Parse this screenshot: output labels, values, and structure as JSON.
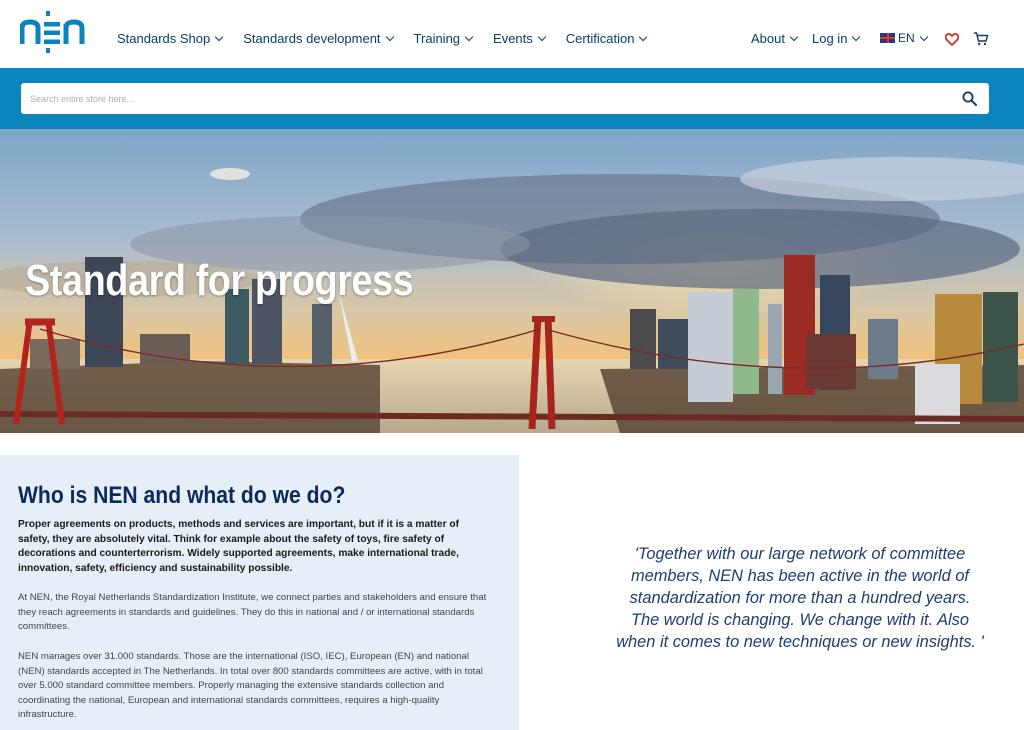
{
  "brand": {
    "logo_text": "nen"
  },
  "nav": {
    "items": [
      {
        "label": "Standards Shop"
      },
      {
        "label": "Standards development"
      },
      {
        "label": "Training"
      },
      {
        "label": "Events"
      },
      {
        "label": "Certification"
      }
    ],
    "about": "About",
    "login": "Log in",
    "language": "EN"
  },
  "search": {
    "placeholder": "Search entire store here..."
  },
  "hero": {
    "title": "Standard for progress"
  },
  "info": {
    "title": "Who is NEN and what do we do?",
    "lead": "Proper agreements on products, methods and services are important, but if it is a matter of safety, they are absolutely vital. Think for example about the safety of toys, fire safety of decorations and counterterrorism. Widely supported agreements, make international trade, innovation, safety, efficiency and sustainability possible.",
    "p1": "At NEN, the Royal Netherlands Standardization Institute, we connect parties and stakeholders and ensure that they reach agreements in standards and guidelines. They do this in national and / or international standards committees.",
    "p2": "NEN manages over 31.000 standards. Those are the international (ISO, IEC), European (EN) and national (NEN) standards accepted in The Netherlands. In total over 800 standards committees are active, with in total over 5.000 standard committee members. Properly managing the extensive standards collection and coordinating the national, European and international standards committees, requires a high-quality infrastructure."
  },
  "quote": {
    "text": "'Together with our large network of committee members, NEN has been active in the world of standardization for more than a hundred years. The world is changing. We change with it. Also when it comes to new techniques or new insights. '"
  },
  "colors": {
    "brand_blue": "#0a84bd",
    "navy": "#0c2a5b",
    "panel": "#e6eef8",
    "heart": "#d0312d"
  }
}
